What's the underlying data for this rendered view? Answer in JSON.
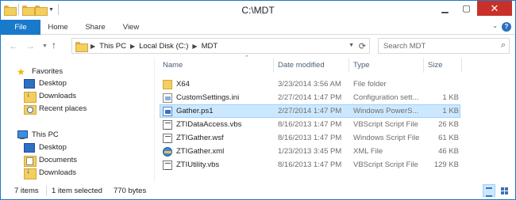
{
  "window": {
    "title": "C:\\MDT",
    "minimize_label": "▁",
    "maximize_label": "▢",
    "close_label": "✕"
  },
  "ribbon": {
    "tabs": [
      {
        "label": "File"
      },
      {
        "label": "Home"
      },
      {
        "label": "Share"
      },
      {
        "label": "View"
      }
    ],
    "help_label": "?"
  },
  "address": {
    "crumbs": [
      "This PC",
      "Local Disk (C:)",
      "MDT"
    ]
  },
  "search": {
    "placeholder": "Search MDT"
  },
  "nav_pane": {
    "favorites": {
      "label": "Favorites",
      "items": [
        "Desktop",
        "Downloads",
        "Recent places"
      ]
    },
    "this_pc": {
      "label": "This PC",
      "items": [
        "Desktop",
        "Documents",
        "Downloads"
      ]
    }
  },
  "columns": {
    "name": "Name",
    "date": "Date modified",
    "type": "Type",
    "size": "Size"
  },
  "files": [
    {
      "name": "X64",
      "date": "3/23/2014 3:56 AM",
      "type": "File folder",
      "size": "",
      "icon": "folder-icon"
    },
    {
      "name": "CustomSettings.ini",
      "date": "2/27/2014 1:47 PM",
      "type": "Configuration sett...",
      "size": "1 KB",
      "icon": "ini-file-icon"
    },
    {
      "name": "Gather.ps1",
      "date": "2/27/2014 1:47 PM",
      "type": "Windows PowerS...",
      "size": "1 KB",
      "icon": "powershell-file-icon",
      "selected": true
    },
    {
      "name": "ZTIDataAccess.vbs",
      "date": "8/16/2013 1:47 PM",
      "type": "VBScript Script File",
      "size": "26 KB",
      "icon": "script-file-icon"
    },
    {
      "name": "ZTIGather.wsf",
      "date": "8/16/2013 1:47 PM",
      "type": "Windows Script File",
      "size": "61 KB",
      "icon": "script-file-icon"
    },
    {
      "name": "ZTIGather.xml",
      "date": "1/23/2013 3:45 PM",
      "type": "XML File",
      "size": "46 KB",
      "icon": "xml-file-icon"
    },
    {
      "name": "ZTIUtility.vbs",
      "date": "8/16/2013 1:47 PM",
      "type": "VBScript Script File",
      "size": "129 KB",
      "icon": "script-file-icon"
    }
  ],
  "status": {
    "item_count": "7 items",
    "selection": "1 item selected",
    "selection_size": "770 bytes"
  },
  "colors": {
    "accent": "#1979ca",
    "selection": "#cce8ff",
    "close_button": "#c7312a"
  }
}
